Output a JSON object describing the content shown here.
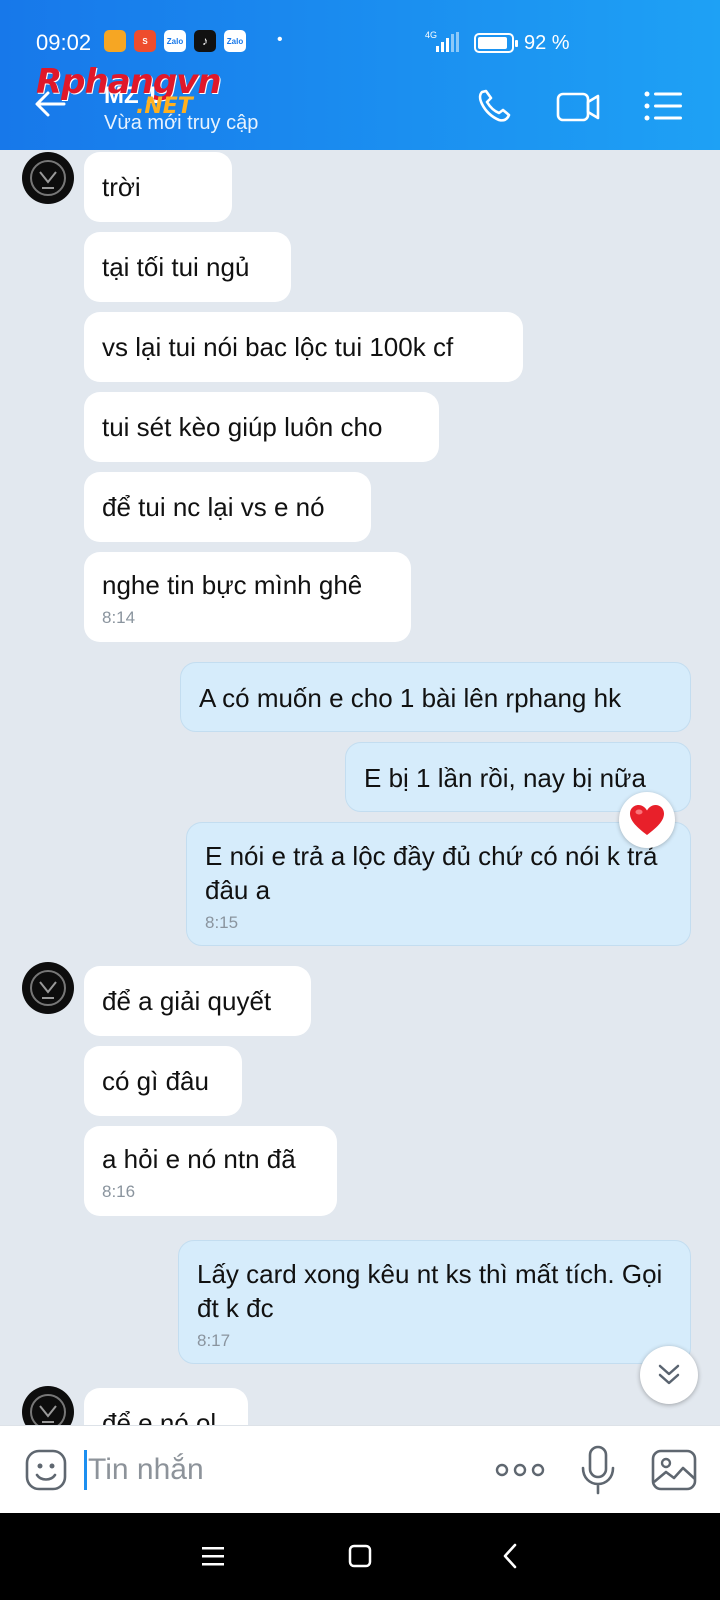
{
  "status_bar": {
    "time": "09:02",
    "notification_icons": [
      "photos-app-icon",
      "shopee-icon",
      "zalo-icon",
      "tiktok-icon",
      "zalo-icon"
    ],
    "notification_labels": [
      "",
      "S",
      "Zalo",
      "♪",
      "Zalo"
    ],
    "network": "4G",
    "battery_level": 0.92,
    "battery_text": "92 %"
  },
  "watermark": {
    "main": "Rphangvn",
    "sub": ".NET"
  },
  "header": {
    "contact_name": "MZ 1",
    "contact_status": "Vừa mới truy cập",
    "accent_color": "#1778ea",
    "actions": [
      "phone-icon",
      "video-call-icon",
      "menu-list-icon"
    ]
  },
  "messages": [
    {
      "sender": "them",
      "text": "trời",
      "time": ""
    },
    {
      "sender": "them",
      "text": "tại tối tui ngủ",
      "time": ""
    },
    {
      "sender": "them",
      "text": "vs lại tui nói bac lộc tui 100k cf",
      "time": ""
    },
    {
      "sender": "them",
      "text": "tui sét kèo giúp luôn cho",
      "time": ""
    },
    {
      "sender": "them",
      "text": "để tui nc lại vs e nó",
      "time": ""
    },
    {
      "sender": "them",
      "text": "nghe tin bực mình ghê",
      "time": "8:14"
    },
    {
      "sender": "me",
      "text": "A có muốn e cho 1 bài lên rphang hk",
      "time": ""
    },
    {
      "sender": "me",
      "text": "E bị 1 lần rồi, nay bị nữa",
      "time": ""
    },
    {
      "sender": "me",
      "text": "E nói e trả a lộc đầy đủ chứ có nói k trả đâu a",
      "time": "8:15",
      "reaction": "heart-icon"
    },
    {
      "sender": "them",
      "text": "để a giải quyết",
      "time": ""
    },
    {
      "sender": "them",
      "text": "có gì đâu",
      "time": ""
    },
    {
      "sender": "them",
      "text": "a hỏi e nó ntn đã",
      "time": "8:16"
    },
    {
      "sender": "me",
      "text": "Lấy card xong kêu nt ks thì mất tích. Gọi đt k đc",
      "time": "8:17"
    },
    {
      "sender": "them",
      "text": "để e nó ol",
      "time": ""
    }
  ],
  "composer": {
    "placeholder": "Tin nhắn"
  },
  "colors": {
    "outgoing_bubble": "#d6ecfb",
    "incoming_bubble": "#ffffff",
    "chat_background": "#e2e8ef",
    "reaction_heart": "#e8202a"
  }
}
